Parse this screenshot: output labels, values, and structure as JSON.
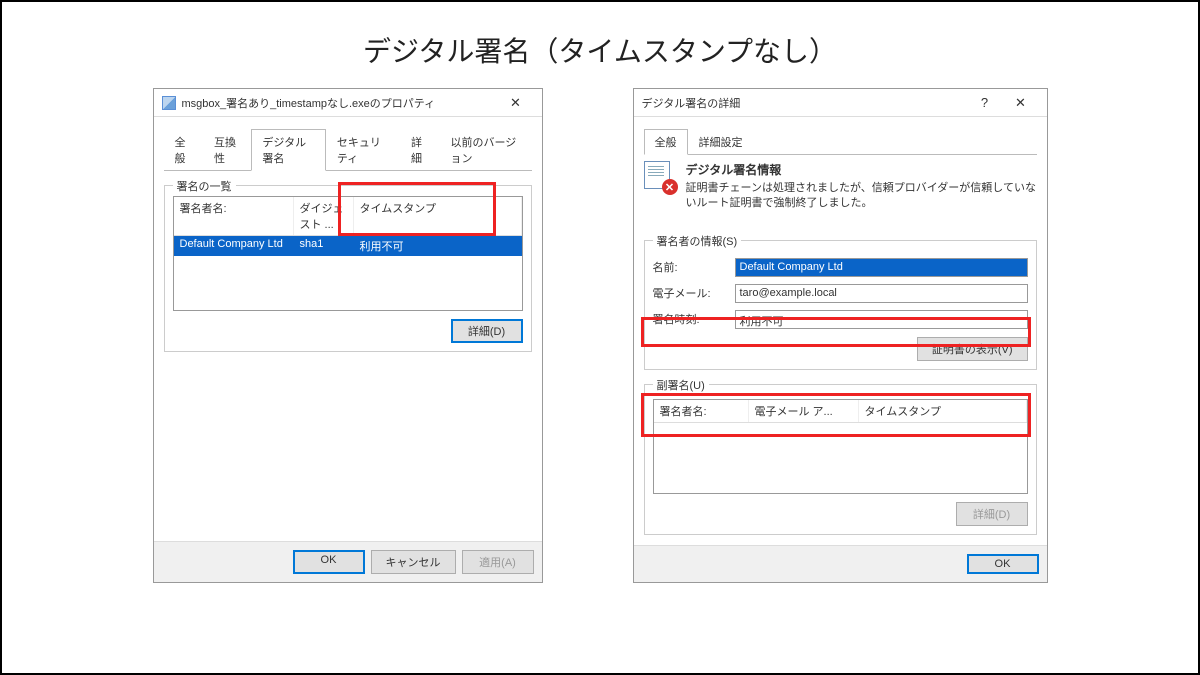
{
  "page": {
    "title": "デジタル署名（タイムスタンプなし）"
  },
  "left": {
    "title": "msgbox_署名あり_timestampなし.exeのプロパティ",
    "tabs": [
      "全般",
      "互換性",
      "デジタル署名",
      "セキュリティ",
      "詳細",
      "以前のバージョン"
    ],
    "active_tab": 2,
    "group_title": "署名の一覧",
    "columns": {
      "signer": "署名者名:",
      "digest": "ダイジェスト ...",
      "timestamp": "タイムスタンプ"
    },
    "row": {
      "signer": "Default Company Ltd",
      "digest": "sha1",
      "timestamp": "利用不可"
    },
    "details_btn": "詳細(D)",
    "footer": {
      "ok": "OK",
      "cancel": "キャンセル",
      "apply": "適用(A)"
    }
  },
  "right": {
    "title": "デジタル署名の詳細",
    "tabs": [
      "全般",
      "詳細設定"
    ],
    "active_tab": 0,
    "info_title": "デジタル署名情報",
    "info_text": "証明書チェーンは処理されましたが、信頼プロバイダーが信頼していないルート証明書で強制終了しました。",
    "signer_group": "署名者の情報(S)",
    "fields": {
      "name_label": "名前:",
      "name_value": "Default Company Ltd",
      "email_label": "電子メール:",
      "email_value": "taro@example.local",
      "time_label": "署名時刻:",
      "time_value": "利用不可"
    },
    "view_cert_btn": "証明書の表示(V)",
    "counter_group": "副署名(U)",
    "counter_columns": {
      "c1": "署名者名:",
      "c2": "電子メール ア...",
      "c3": "タイムスタンプ"
    },
    "details_btn": "詳細(D)",
    "footer": {
      "ok": "OK"
    }
  }
}
